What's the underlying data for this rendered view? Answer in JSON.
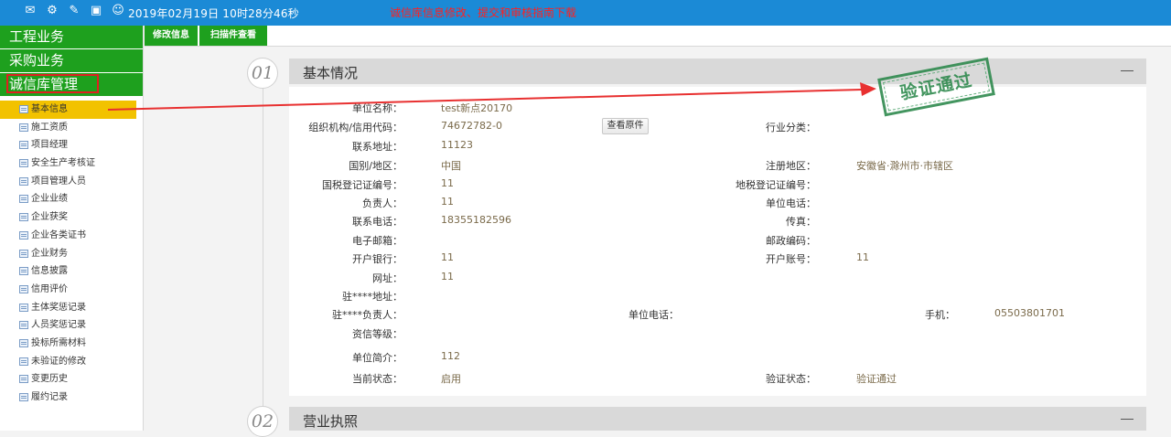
{
  "topbar": {
    "icons": [
      "message-icon",
      "gear-icon",
      "wrench-icon",
      "gift-icon",
      "user-circle-icon"
    ],
    "datetime": "2019年02月19日 10时28分46秒",
    "notice": "诚信库信息修改、提交和审核指南下载"
  },
  "nav": {
    "main": [
      "工程业务",
      "采购业务",
      "诚信库管理"
    ],
    "sub": [
      "基本信息",
      "施工资质",
      "项目经理",
      "安全生产考核证",
      "项目管理人员",
      "企业业绩",
      "企业获奖",
      "企业各类证书",
      "企业财务",
      "信息披露",
      "信用评价",
      "主体奖惩记录",
      "人员奖惩记录",
      "投标所需材料",
      "未验证的修改",
      "变更历史",
      "履约记录"
    ],
    "active_index": 0
  },
  "tabs": [
    "修改信息",
    "扫描件查看"
  ],
  "section1": {
    "num": "01",
    "title": "基本情况",
    "stamp": "验证通过",
    "view_button": "查看原件",
    "fields": {
      "unit_name_label": "单位名称：",
      "unit_name": "test新点20170",
      "org_code_label": "组织机构/信用代码：",
      "org_code": "74672782-0",
      "industry_label": "行业分类：",
      "industry": "",
      "address_label": "联系地址：",
      "address": "11123",
      "country_label": "国别/地区：",
      "country": "中国",
      "reg_area_label": "注册地区：",
      "reg_area": "安徽省·滁州市·市辖区",
      "national_tax_label": "国税登记证编号：",
      "national_tax": "11",
      "local_tax_label": "地税登记证编号：",
      "local_tax": "",
      "principal_label": "负责人：",
      "principal": "11",
      "unit_phone_label": "单位电话：",
      "unit_phone": "",
      "contact_phone_label": "联系电话：",
      "contact_phone": "18355182596",
      "fax_label": "传真：",
      "fax": "",
      "email_label": "电子邮箱：",
      "email": "",
      "zip_label": "邮政编码：",
      "zip": "",
      "bank_label": "开户银行：",
      "bank": "11",
      "account_label": "开户账号：",
      "account": "11",
      "website_label": "网址：",
      "website": "11",
      "office_addr_label": "驻****地址：",
      "office_addr": "",
      "office_head_label": "驻****负责人：",
      "office_head": "",
      "office_phone_label": "单位电话：",
      "office_phone": "",
      "mobile_label": "手机：",
      "mobile": "05503801701",
      "credit_level_label": "资信等级：",
      "credit_level": "",
      "intro_label": "单位简介：",
      "intro": "112",
      "status_label": "当前状态：",
      "status": "启用",
      "verify_label": "验证状态：",
      "verify": "验证通过"
    }
  },
  "section2": {
    "num": "02",
    "title": "营业执照"
  },
  "colors": {
    "topbar": "#1b8ad6",
    "nav_green": "#1ea01e",
    "active_yellow": "#f2c200",
    "highlight_red": "#e02020",
    "stamp_green": "#2f8a4e"
  }
}
